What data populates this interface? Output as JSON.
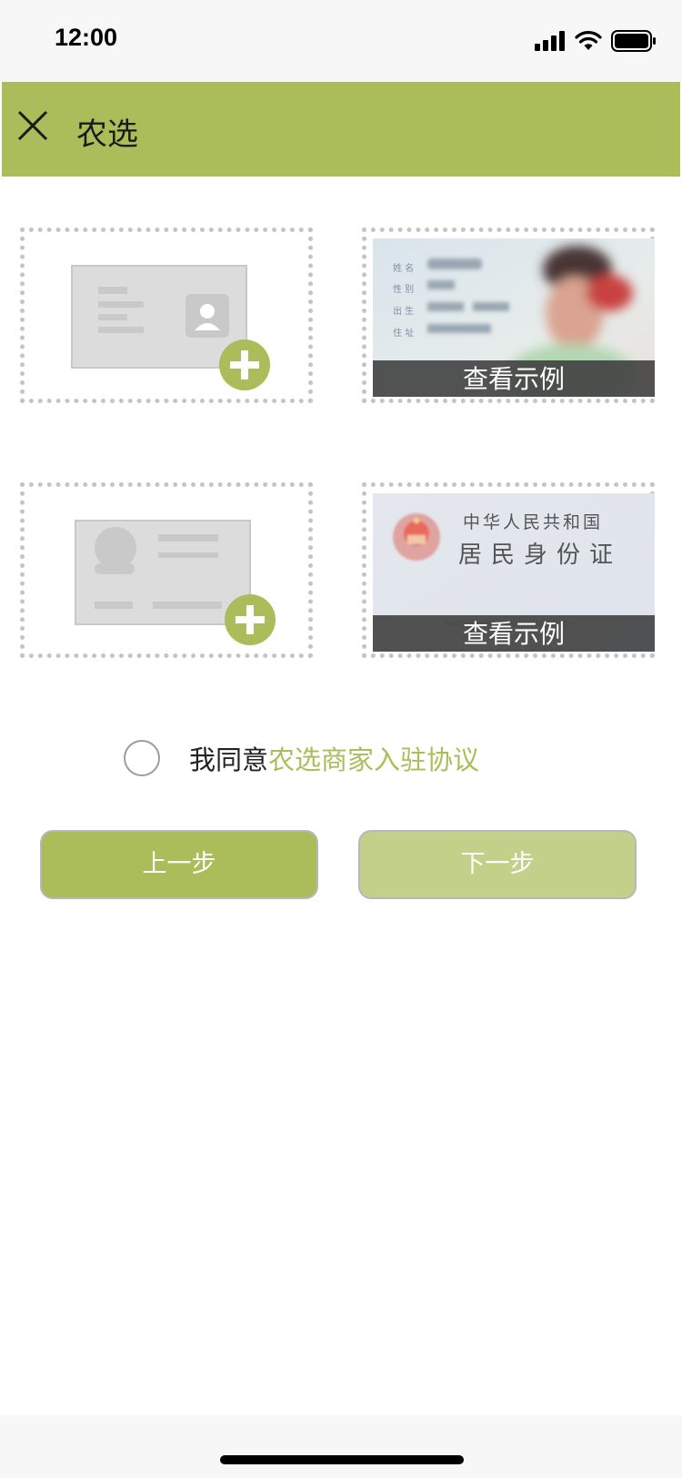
{
  "status_bar": {
    "time": "12:00"
  },
  "app_bar": {
    "title": "农选",
    "close_icon": "close-icon"
  },
  "uploads": [
    {
      "side": "portrait",
      "icon": "add-plus-icon",
      "sample_caption": "查看示例"
    },
    {
      "side": "emblem",
      "icon": "add-plus-icon",
      "sample_caption": "查看示例"
    }
  ],
  "sample_card_text": {
    "front_fields": [
      "姓 名",
      "性 别",
      "出 生",
      "住 址"
    ],
    "back_line1": "中华人民共和国",
    "back_line2": "居民身份证"
  },
  "agreement": {
    "prefix": "我同意",
    "link": "农选商家入驻协议",
    "checked": false
  },
  "buttons": {
    "prev": "上一步",
    "next": "下一步"
  },
  "colors": {
    "accent": "#abbd5a",
    "accent_disabled": "#c3d08a"
  }
}
